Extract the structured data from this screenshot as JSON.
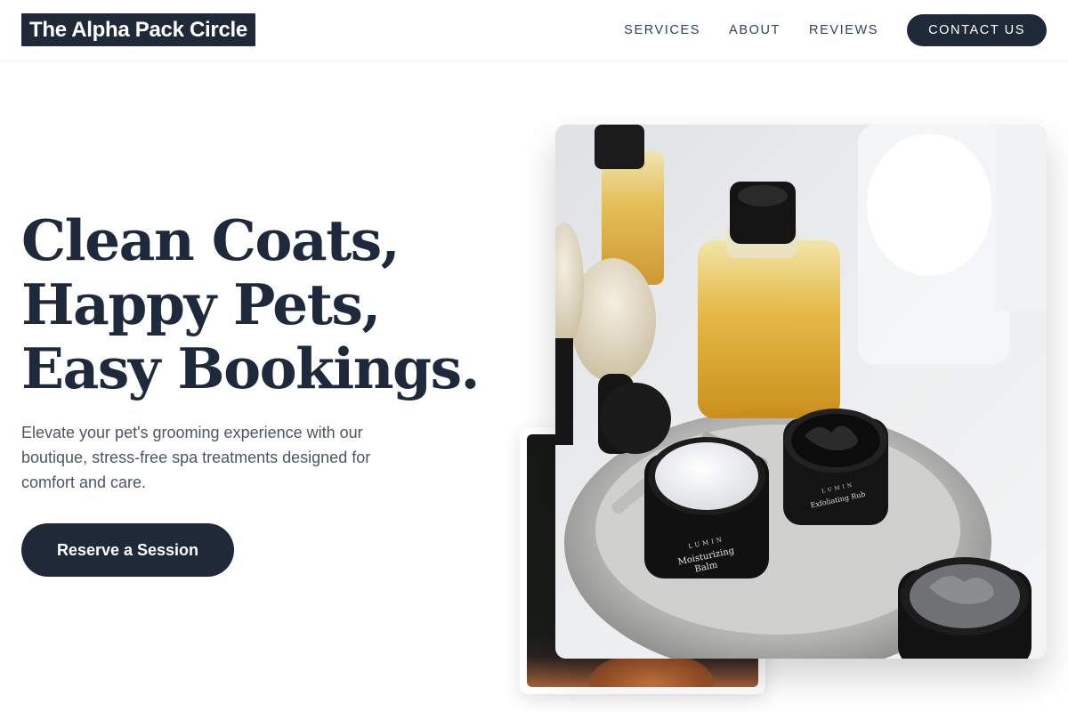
{
  "header": {
    "logo": "The Alpha Pack Circle",
    "nav": [
      {
        "label": "SERVICES"
      },
      {
        "label": "ABOUT"
      },
      {
        "label": "REVIEWS"
      }
    ],
    "contact_label": "CONTACT US"
  },
  "hero": {
    "headline": [
      "Clean Coats,",
      "Happy Pets,",
      "Easy Bookings."
    ],
    "subtext": "Elevate your pet's grooming experience with our boutique, stress-free spa treatments designed for comfort and care.",
    "cta_label": "Reserve a Session"
  },
  "images": {
    "main_photo": {
      "jar_brand": "LUMIN",
      "jar_left_label": [
        "Moisturizing",
        "Balm"
      ],
      "jar_right_label": "Exfoliating Rub"
    }
  },
  "colors": {
    "primary": "#1f2937",
    "text": "#1e293b",
    "muted": "#4b5563",
    "background": "#ffffff"
  }
}
